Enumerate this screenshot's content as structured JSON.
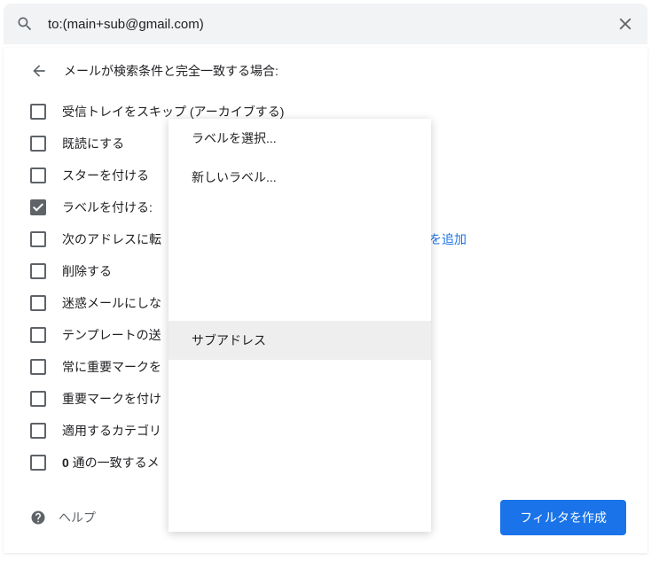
{
  "search": {
    "query": "to:(main+sub@gmail.com)"
  },
  "header": "メールが検索条件と完全一致する場合:",
  "options": [
    {
      "label": "受信トレイをスキップ (アーカイブする)",
      "checked": false
    },
    {
      "label": "既読にする",
      "checked": false
    },
    {
      "label": "スターを付ける",
      "checked": false
    },
    {
      "label": "ラベルを付ける:",
      "checked": true
    },
    {
      "label": "次のアドレスに転",
      "checked": false,
      "link_suffix": "スを追加"
    },
    {
      "label": "削除する",
      "checked": false
    },
    {
      "label": "迷惑メールにしな",
      "checked": false
    },
    {
      "label": "テンプレートの送",
      "checked": false
    },
    {
      "label": "常に重要マークを",
      "checked": false
    },
    {
      "label": "重要マークを付け",
      "checked": false
    },
    {
      "label": "適用するカテゴリ",
      "checked": false
    },
    {
      "label_prefix": "0",
      "label_rest": " 通の一致するメ",
      "checked": false
    }
  ],
  "dropdown": {
    "items": [
      {
        "label": "ラベルを選択...",
        "highlighted": false
      },
      {
        "label": "新しいラベル...",
        "highlighted": false
      }
    ],
    "highlighted_item": "サブアドレス"
  },
  "footer": {
    "help": "ヘルプ",
    "create_button": "フィルタを作成"
  }
}
